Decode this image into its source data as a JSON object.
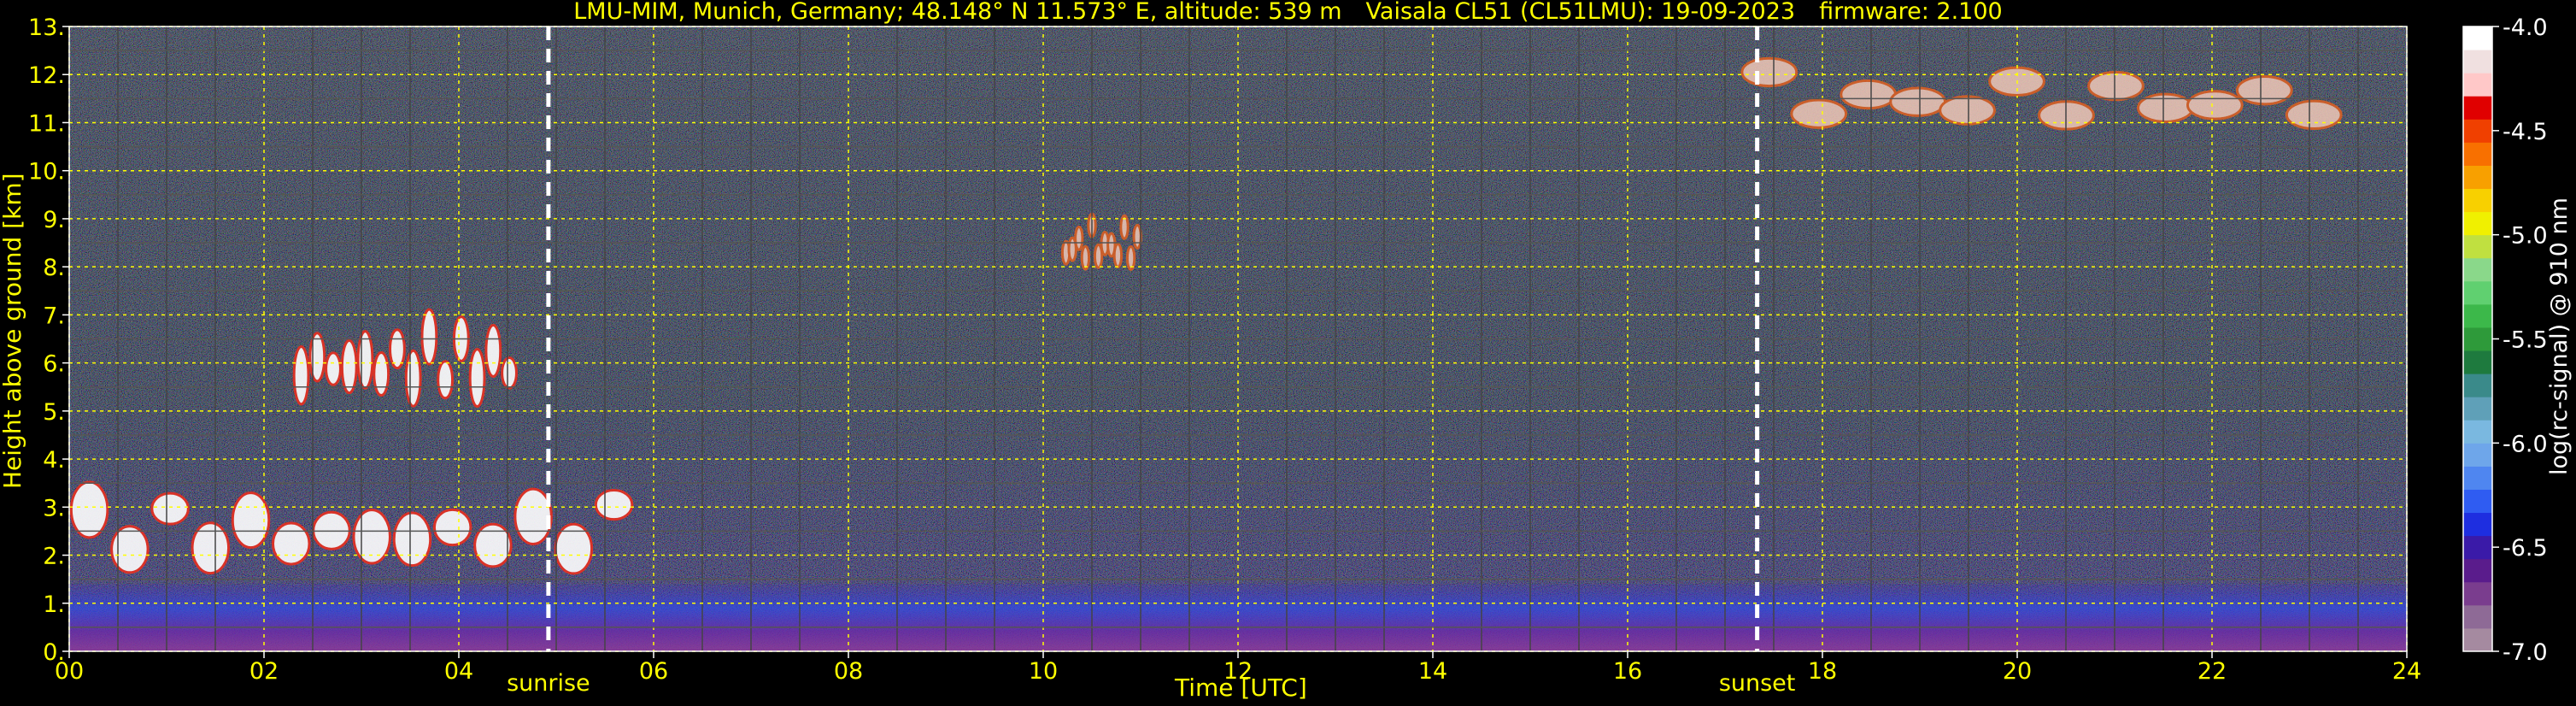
{
  "title": {
    "station": "LMU-MIM, Munich, Germany; 48.148° N 11.573° E, altitude: 539 m",
    "instrument": "Vaisala CL51 (CL51LMU): 19-09-2023",
    "firmware": "firmware: 2.100"
  },
  "events": {
    "sunrise_label": "sunrise",
    "sunrise_hour": 4.92,
    "sunset_label": "sunset",
    "sunset_hour": 17.33
  },
  "chart_data": {
    "type": "heatmap",
    "xlabel": "Time [UTC]",
    "ylabel": "Height above ground [km]",
    "xlim": [
      0,
      24
    ],
    "ylim": [
      0,
      13
    ],
    "x_ticks": [
      "00",
      "02",
      "04",
      "06",
      "08",
      "10",
      "12",
      "14",
      "16",
      "18",
      "20",
      "22",
      "24"
    ],
    "y_ticks": [
      "0.",
      "1.",
      "2.",
      "3.",
      "4.",
      "5.",
      "6.",
      "7.",
      "8.",
      "9.",
      "10.",
      "11.",
      "12.",
      "13."
    ],
    "grid": true,
    "colorbar": {
      "label": "log(rc-signal) @ 910 nm",
      "range": [
        -7.0,
        -4.0
      ],
      "ticks": [
        "-4.0",
        "-4.5",
        "-5.0",
        "-5.5",
        "-6.0",
        "-6.5",
        "-7.0"
      ],
      "tick_values": [
        -4.0,
        -4.5,
        -5.0,
        -5.5,
        -6.0,
        -6.5,
        -7.0
      ],
      "colors": [
        "#a58aa0",
        "#8e6a96",
        "#7a3d8e",
        "#5a1c8c",
        "#3a1aa8",
        "#1e2ee0",
        "#2f5cf2",
        "#4f86f0",
        "#6ea6ea",
        "#7ab8e0",
        "#5fa0b8",
        "#3a8a8a",
        "#1e7a3e",
        "#2e9a3a",
        "#3cb84a",
        "#60d070",
        "#8ad88a",
        "#c0e040",
        "#f0f000",
        "#f8d000",
        "#f8a000",
        "#f87000",
        "#f04000",
        "#e00000",
        "#ffc8c8",
        "#f0e0e0",
        "#ffffff"
      ]
    },
    "features": [
      {
        "kind": "cirrus_layer",
        "x_range": [
          17.2,
          23.3
        ],
        "z_range": [
          10.7,
          12.5
        ]
      },
      {
        "kind": "cirrus_layer",
        "x_range": [
          10.2,
          11.0
        ],
        "z_range": [
          7.8,
          9.3
        ]
      },
      {
        "kind": "cloud_layer",
        "x_range": [
          2.3,
          4.6
        ],
        "z_range": [
          4.9,
          7.4
        ]
      },
      {
        "kind": "cloud_layer",
        "x_range": [
          0.0,
          5.8
        ],
        "z_range": [
          1.4,
          3.8
        ]
      },
      {
        "kind": "boundary_layer",
        "x_range": [
          0,
          24
        ],
        "z_range": [
          0.0,
          1.4
        ]
      }
    ]
  }
}
